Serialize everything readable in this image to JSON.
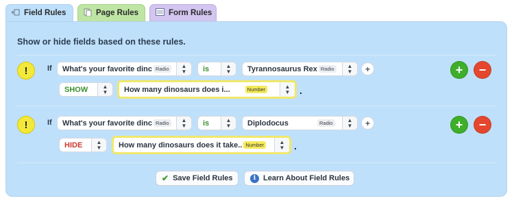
{
  "tabs": [
    {
      "label": "Field Rules",
      "icon": "field-rules-icon",
      "active": true
    },
    {
      "label": "Page Rules",
      "icon": "page-rules-icon",
      "active": false
    },
    {
      "label": "Form Rules",
      "icon": "form-rules-icon",
      "active": false
    }
  ],
  "heading": "Show or hide fields based on these rules.",
  "colors": {
    "panel": "#bfe0fb",
    "show": "#3a8f2c",
    "hide": "#c93a2e",
    "highlight": "#f0e76a",
    "add": "#3fae2b",
    "remove": "#e4472e"
  },
  "rules": [
    {
      "if_label": "If",
      "field": {
        "text": "What's your favorite dinc",
        "tag": "Radio"
      },
      "operator": "is",
      "value": {
        "text": "Tyrannosaurus Rex",
        "tag": "Radio"
      },
      "action": "SHOW",
      "target": {
        "text": "How many dinosaurs does i...",
        "tag": "Number"
      }
    },
    {
      "if_label": "If",
      "field": {
        "text": "What's your favorite dinc",
        "tag": "Radio"
      },
      "operator": "is",
      "value": {
        "text": "Diplodocus",
        "tag": "Radio"
      },
      "action": "HIDE",
      "target": {
        "text": "How many dinosaurs does it take..",
        "tag": "Number"
      }
    }
  ],
  "symbols": {
    "warning": "!",
    "plus": "+",
    "minus": "−",
    "period": "."
  },
  "buttons": {
    "save": "Save Field Rules",
    "learn": "Learn About Field Rules"
  }
}
